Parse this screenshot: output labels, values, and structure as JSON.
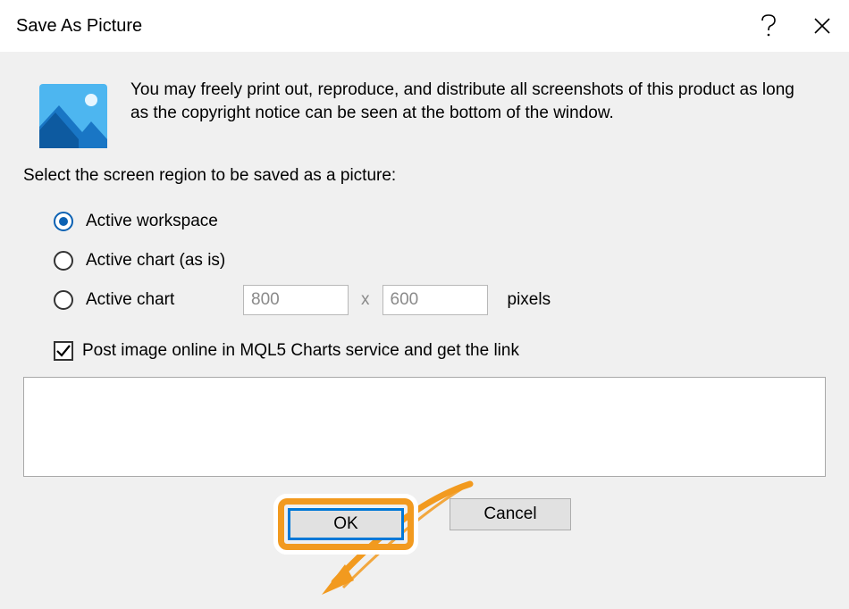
{
  "titlebar": {
    "title": "Save As Picture",
    "help_icon": "?",
    "close_icon": "✕"
  },
  "intro": {
    "text": "You may freely print out, reproduce, and distribute all screenshots of this product as long as the copyright notice can be seen at the bottom of the window."
  },
  "select_label": "Select the screen region to be saved as a picture:",
  "options": {
    "active_workspace": "Active workspace",
    "active_chart_asis": "Active chart (as is)",
    "active_chart": "Active chart",
    "width": "800",
    "height": "600",
    "x": "x",
    "pixels": "pixels"
  },
  "checkbox": {
    "label": "Post image online in MQL5 Charts service and get the link",
    "checked": true
  },
  "buttons": {
    "ok": "OK",
    "cancel": "Cancel"
  }
}
